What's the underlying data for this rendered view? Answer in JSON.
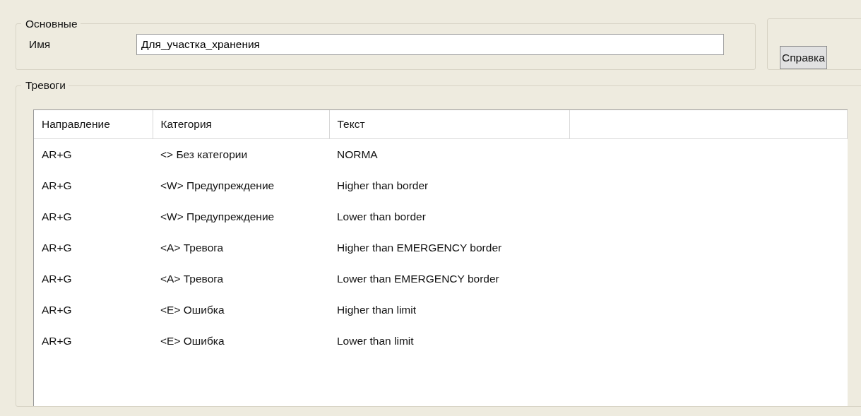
{
  "main_group": {
    "title": "Основные",
    "name_label": "Имя",
    "name_value": "Для_участка_хранения"
  },
  "help_button": "Справка",
  "alarms_group": {
    "title": "Тревоги",
    "table": {
      "columns": [
        "Направление",
        "Категория",
        "Текст"
      ],
      "rows": [
        [
          "AR+G",
          "<> Без категории",
          "NORMA"
        ],
        [
          "AR+G",
          "<W> Предупреждение",
          "Higher than border"
        ],
        [
          "AR+G",
          "<W> Предупреждение",
          "Lower than border"
        ],
        [
          "AR+G",
          "<A> Тревога",
          "Higher than EMERGENCY border"
        ],
        [
          "AR+G",
          "<A> Тревога",
          "Lower than EMERGENCY border"
        ],
        [
          "AR+G",
          "<E> Ошибка",
          "Higher than limit"
        ],
        [
          "AR+G",
          "<E> Ошибка",
          "Lower than limit"
        ]
      ]
    }
  }
}
